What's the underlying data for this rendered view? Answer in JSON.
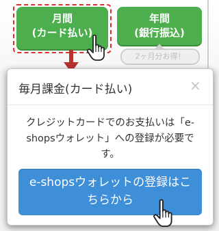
{
  "plans": {
    "monthly": {
      "line1": "月間",
      "line2": "(カード払い)"
    },
    "yearly": {
      "line1": "年間",
      "line2": "(銀行振込)"
    },
    "yearly_note": "2ヶ月分お得！"
  },
  "modal": {
    "title": "毎月課金(カード払い)",
    "close_label": "×",
    "body": "クレジットカードでのお支払いは「e-shopsウォレット」への登録が必要です。",
    "button_label": "e-shopsウォレットの登録はこちらから"
  },
  "colors": {
    "plan_green": "#4cae4c",
    "highlight_red": "#d9302c",
    "button_blue": "#3f8fd8"
  },
  "icons": [
    "pointer-hand-icon",
    "down-arrow-icon",
    "close-icon"
  ]
}
